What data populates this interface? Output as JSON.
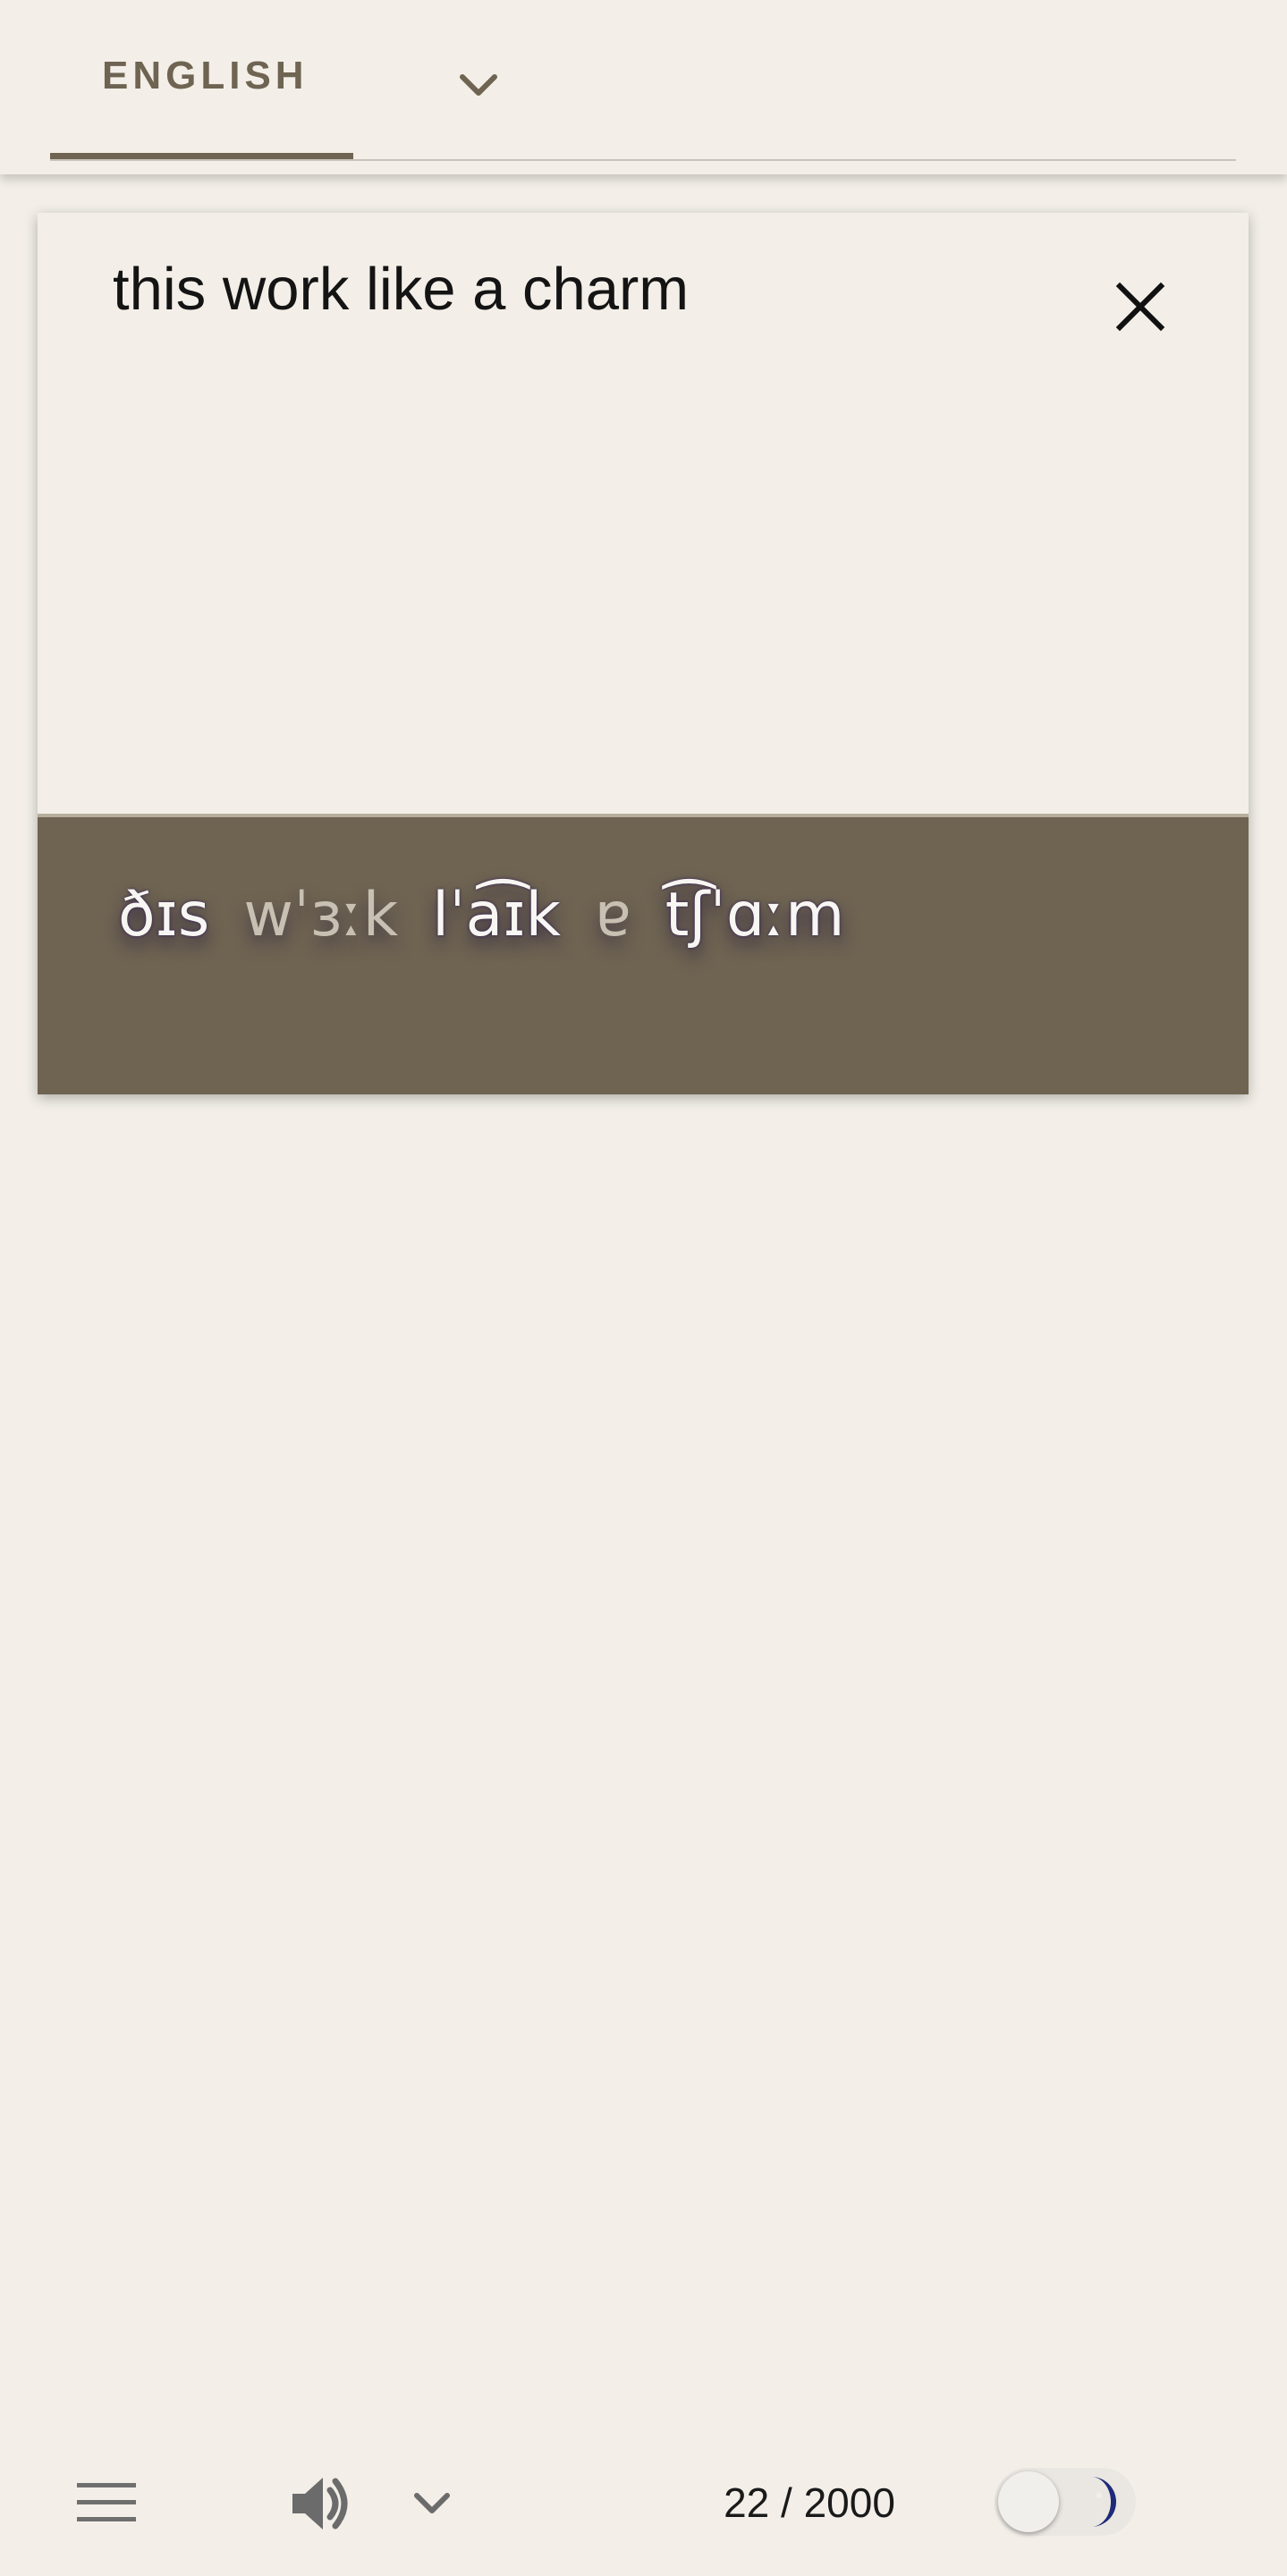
{
  "header": {
    "language_label": "ENGLISH",
    "dropdown_icon": "chevron-down-icon"
  },
  "input": {
    "text": "this work like a charm",
    "clear_icon": "close-icon"
  },
  "output": {
    "ipa_words": [
      {
        "text": "ðɪs"
      },
      {
        "text": "wˈɜːk"
      },
      {
        "text": "lˈa͡ɪk"
      },
      {
        "text": "ɐ"
      },
      {
        "text": "t͡ʃˈɑːm"
      }
    ]
  },
  "bottom_bar": {
    "menu_icon": "hamburger-menu-icon",
    "speaker_icon": "speaker-icon",
    "voice_dropdown_icon": "chevron-down-icon",
    "char_count": "22 / 2000",
    "theme_toggle_icon": "moon-icon"
  },
  "colors": {
    "background": "#f3efe8",
    "accent": "#6f6452",
    "output_background": "#6f6452",
    "moon": "#1f2a7a"
  }
}
